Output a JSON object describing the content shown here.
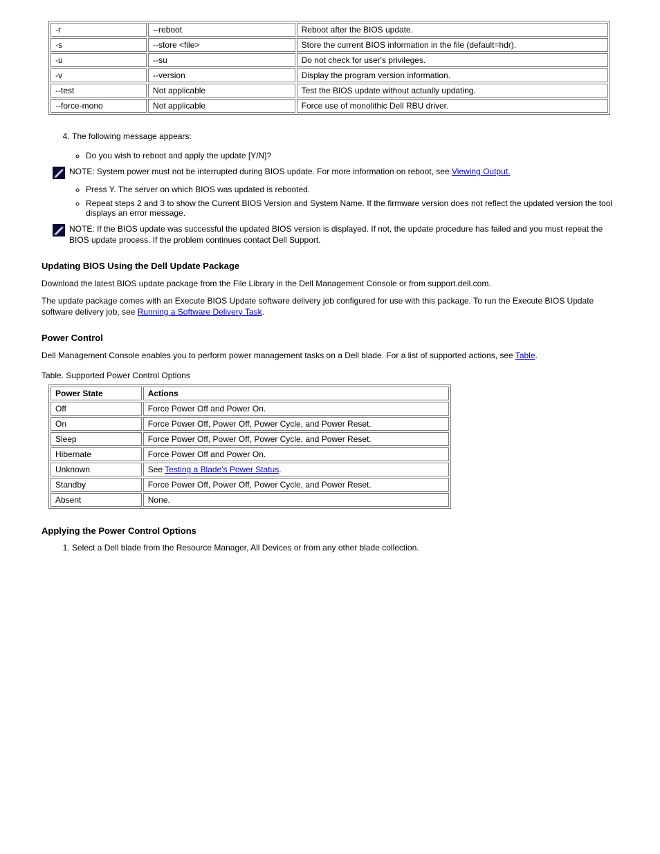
{
  "table1": {
    "rows": [
      {
        "c0": "-r",
        "c1": "--reboot",
        "c2": "Reboot after the BIOS update."
      },
      {
        "c0": "-s",
        "c1": "--store <file>",
        "c2": "Store the current BIOS information in the file (default=hdr)."
      },
      {
        "c0": "-u",
        "c1": "--su",
        "c2": "Do not check for user's privileges."
      },
      {
        "c0": "-v",
        "c1": "--version",
        "c2": "Display the program version information."
      },
      {
        "c0": "--test",
        "c1": "Not applicable",
        "c2": "Test the BIOS update without actually updating."
      },
      {
        "c0": "--force-mono",
        "c1": "Not applicable",
        "c2": "Force use of monolithic Dell RBU driver."
      }
    ]
  },
  "step4": "The following message appears:",
  "step4_sub": "Do you wish to reboot and apply the update [Y/N]?",
  "note1_label": "NOTE: ",
  "note1_text": "System power must not be interrupted during BIOS update. For more information on reboot, see ",
  "note1_link": "Viewing Output.",
  "step5": "Press Y. The server on which BIOS was updated is rebooted.",
  "step6": "Repeat steps 2 and 3 to show the Current BIOS Version and System Name. If the firmware version does not reflect the updated version the tool displays an error message.",
  "note2_label": "NOTE: ",
  "note2_text": "If the BIOS update was successful the updated BIOS version is displayed. If not, the update procedure has failed and you must repeat the BIOS update process. If the problem continues contact Dell Support.",
  "h_update_dup": "Updating BIOS Using the Dell Update Package",
  "dup_p1": "Download the latest BIOS update package from the File Library in the Dell Management Console or from support.dell.com.",
  "dup_p2": "The update package comes with an Execute BIOS Update software delivery job configured for use with this package. To run the Execute BIOS Update software delivery job, see ",
  "dup_link": "Running a Software Delivery Task",
  "dup_p2b": ".",
  "h_power": "Power Control",
  "power_p1": "Dell Management Console enables you to perform power management tasks on a Dell blade. For a list of supported actions, see ",
  "power_table_link": "Table",
  "power_p1b": ".",
  "table2_caption": "Table. Supported Power Control Options ",
  "table2": {
    "header": [
      "Power State",
      "Actions"
    ],
    "rows": [
      {
        "c0": "Off",
        "c1": "Force Power Off and Power On."
      },
      {
        "c0": "On",
        "c1": "Force Power Off, Power Off, Power Cycle, and Power Reset."
      },
      {
        "c0": "Sleep",
        "c1": "Force Power Off, Power Off, Power Cycle, and Power Reset."
      },
      {
        "c0": "Hibernate",
        "c1": "Force Power Off and Power On."
      },
      {
        "c0": "Unknown",
        "c1": "See Testing a Blade's Power Status."
      },
      {
        "c0": "Standby",
        "c1": "Force Power Off, Power Off, Power Cycle, and Power Reset."
      },
      {
        "c0": "Absent",
        "c1": "None."
      }
    ]
  },
  "h_applying": "Applying the Power Control Options",
  "step_power_1": "Select a Dell blade from the Resource Manager, All Devices or from any other blade collection."
}
